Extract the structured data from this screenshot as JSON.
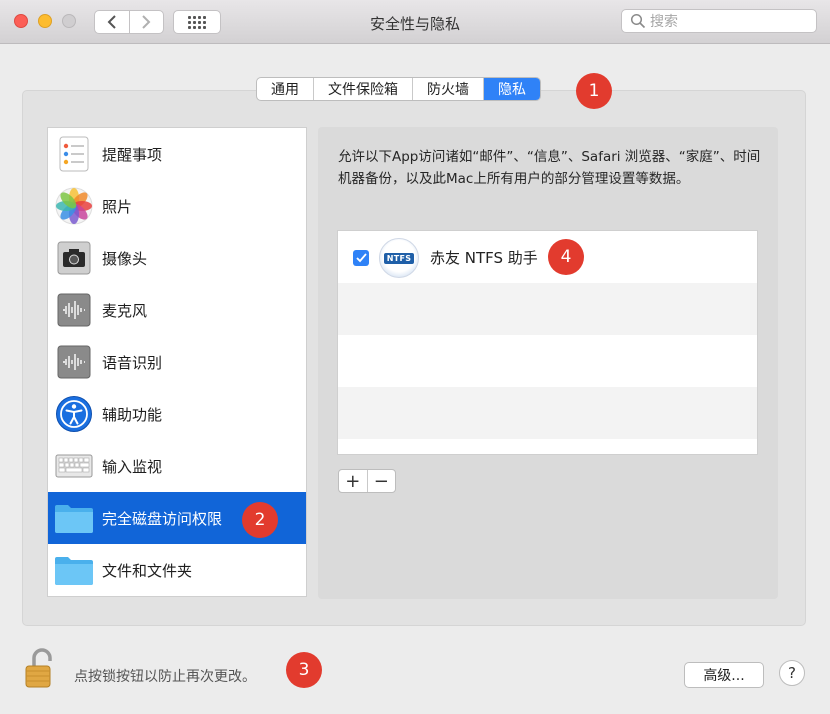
{
  "window": {
    "title": "安全性与隐私"
  },
  "search": {
    "placeholder": "搜索"
  },
  "tabs": [
    {
      "label": "通用",
      "active": false
    },
    {
      "label": "文件保险箱",
      "active": false
    },
    {
      "label": "防火墙",
      "active": false
    },
    {
      "label": "隐私",
      "active": true
    }
  ],
  "sidebar": {
    "items": [
      {
        "label": "提醒事项",
        "icon": "reminders-icon"
      },
      {
        "label": "照片",
        "icon": "photos-icon"
      },
      {
        "label": "摄像头",
        "icon": "camera-icon"
      },
      {
        "label": "麦克风",
        "icon": "microphone-icon"
      },
      {
        "label": "语音识别",
        "icon": "speech-recognition-icon"
      },
      {
        "label": "辅助功能",
        "icon": "accessibility-icon"
      },
      {
        "label": "输入监视",
        "icon": "keyboard-icon"
      },
      {
        "label": "完全磁盘访问权限",
        "icon": "folder-icon",
        "selected": true
      },
      {
        "label": "文件和文件夹",
        "icon": "folder-icon"
      }
    ]
  },
  "main": {
    "description": "允许以下App访问诸如“邮件”、“信息”、Safari 浏览器、“家庭”、时间机器备份，以及此Mac上所有用户的部分管理设置等数据。",
    "apps": [
      {
        "name": "赤友 NTFS 助手",
        "checked": true,
        "icon_text": "NTFS"
      }
    ],
    "add_label": "+",
    "remove_label": "−"
  },
  "footer": {
    "lock_text": "点按锁按钮以防止再次更改。",
    "advanced_label": "高级...",
    "help_label": "?"
  },
  "callouts": [
    "1",
    "2",
    "3",
    "4"
  ],
  "colors": {
    "accent": "#2f82f7",
    "selection": "#1165d8",
    "callout": "#e23b2e"
  }
}
